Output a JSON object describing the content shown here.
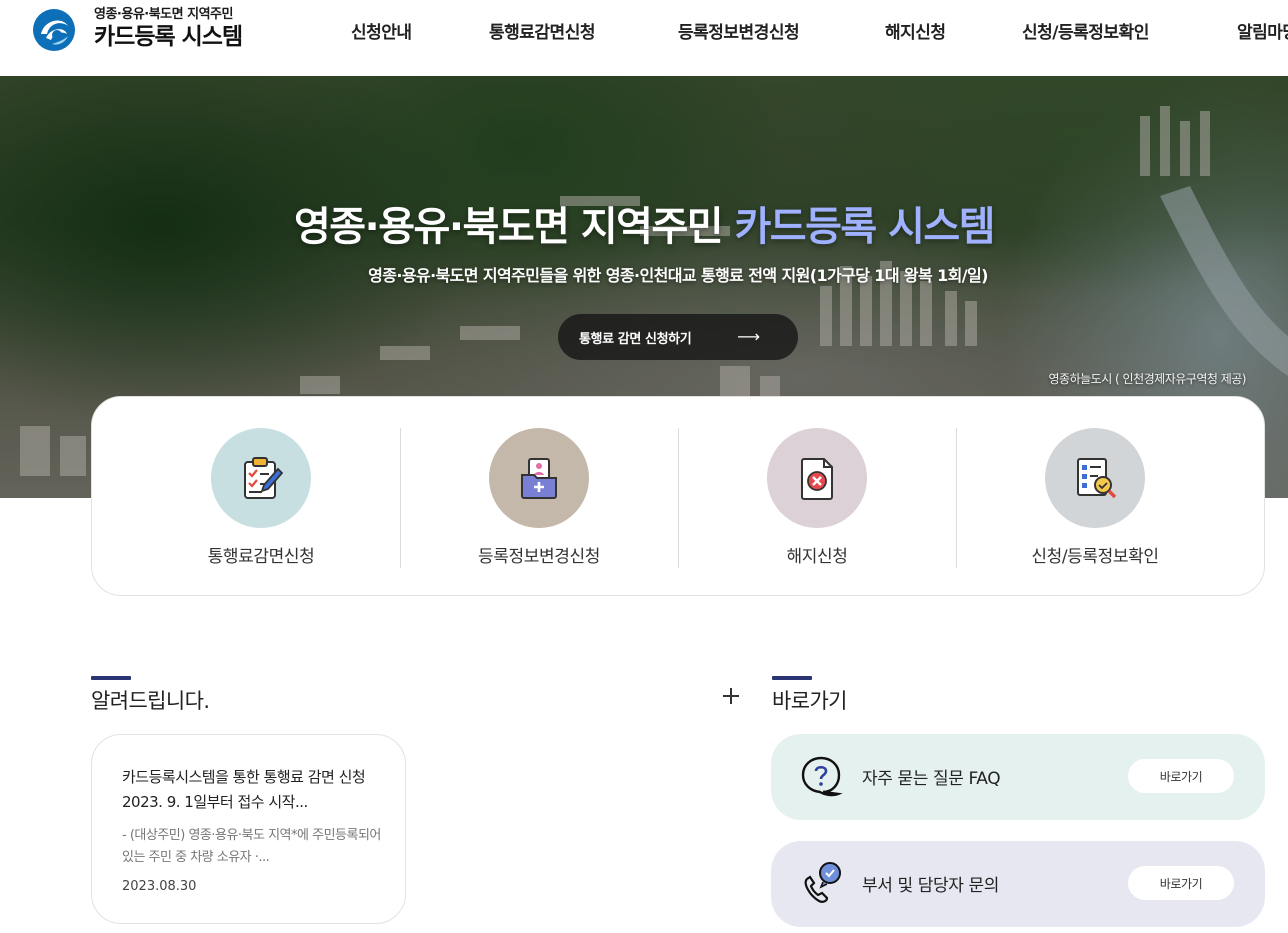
{
  "header": {
    "logo_sub": "영종·용유·북도면 지역주민",
    "logo_main": "카드등록 시스템",
    "nav": [
      "신청안내",
      "통행료감면신청",
      "등록정보변경신청",
      "해지신청",
      "신청/등록정보확인",
      "알림마당"
    ]
  },
  "hero": {
    "title_main": "영종·용유·북도면 지역주민 ",
    "title_accent": "카드등록 시스템",
    "description": "영종·용유·북도면 지역주민들을 위한 영종·인천대교 통행료 전액 지원(1가구당 1대 왕복 1회/일)",
    "button_label": "통행료 감면 신청하기",
    "button_arrow": "⟶",
    "caption": "영종하늘도시 ( 인천경제자유구역청 제공)"
  },
  "quick_menu": [
    {
      "label": "통행료감면신청",
      "icon": "checklist-icon",
      "color": "#c8dfe2"
    },
    {
      "label": "등록정보변경신청",
      "icon": "folder-profile-icon",
      "color": "#c4b8aa"
    },
    {
      "label": "해지신청",
      "icon": "document-cancel-icon",
      "color": "#dbd1d6"
    },
    {
      "label": "신청/등록정보확인",
      "icon": "document-search-icon",
      "color": "#d1d5d8"
    }
  ],
  "notice": {
    "section_title": "알려드립니다.",
    "more_icon": "plus-icon",
    "item": {
      "title": "카드등록시스템을 통한 통행료 감면 신청 2023. 9. 1일부터 접수 시작...",
      "body": "- (대상주민) 영종·용유·북도 지역*에 주민등록되어 있는 주민 중 차량 소유자 ·...",
      "date": "2023.08.30"
    }
  },
  "shortcuts": {
    "section_title": "바로가기",
    "items": [
      {
        "label": "자주 묻는 질문 FAQ",
        "button": "바로가기",
        "icon": "question-bubble-icon",
        "color": "#e5f1ef"
      },
      {
        "label": "부서 및 담당자 문의",
        "button": "바로가기",
        "icon": "phone-chat-icon",
        "color": "#e7e7f1"
      }
    ]
  },
  "colors": {
    "accent": "#9fb1ff",
    "section_bar": "#2c3573"
  }
}
